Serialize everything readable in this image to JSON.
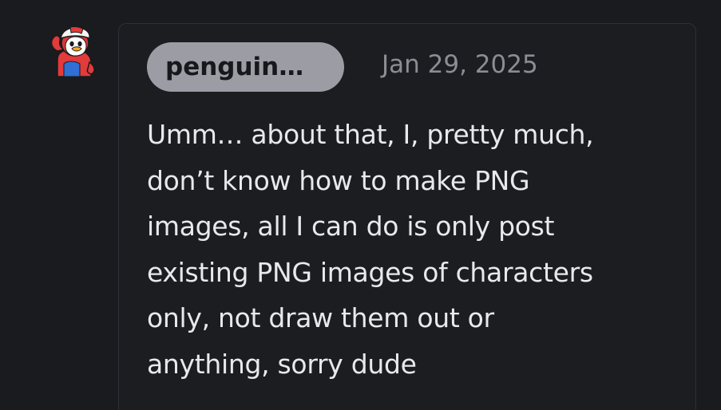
{
  "post": {
    "username": "penguin…",
    "date": "Jan 29, 2025",
    "body_lines": [
      "Umm… about that, I, pretty much,",
      "don’t know how to make PNG",
      "images, all I can do is only post",
      "existing PNG images of characters",
      "only, not draw them out or",
      "anything, sorry dude"
    ]
  },
  "icons": {
    "avatar": "penguin-avatar-icon"
  },
  "colors": {
    "background": "#191b1f",
    "card_border": "#2c2f35",
    "username_pill": "#9b9ca4",
    "date_text": "#8a8d94",
    "body_text": "#e8e9eb"
  }
}
